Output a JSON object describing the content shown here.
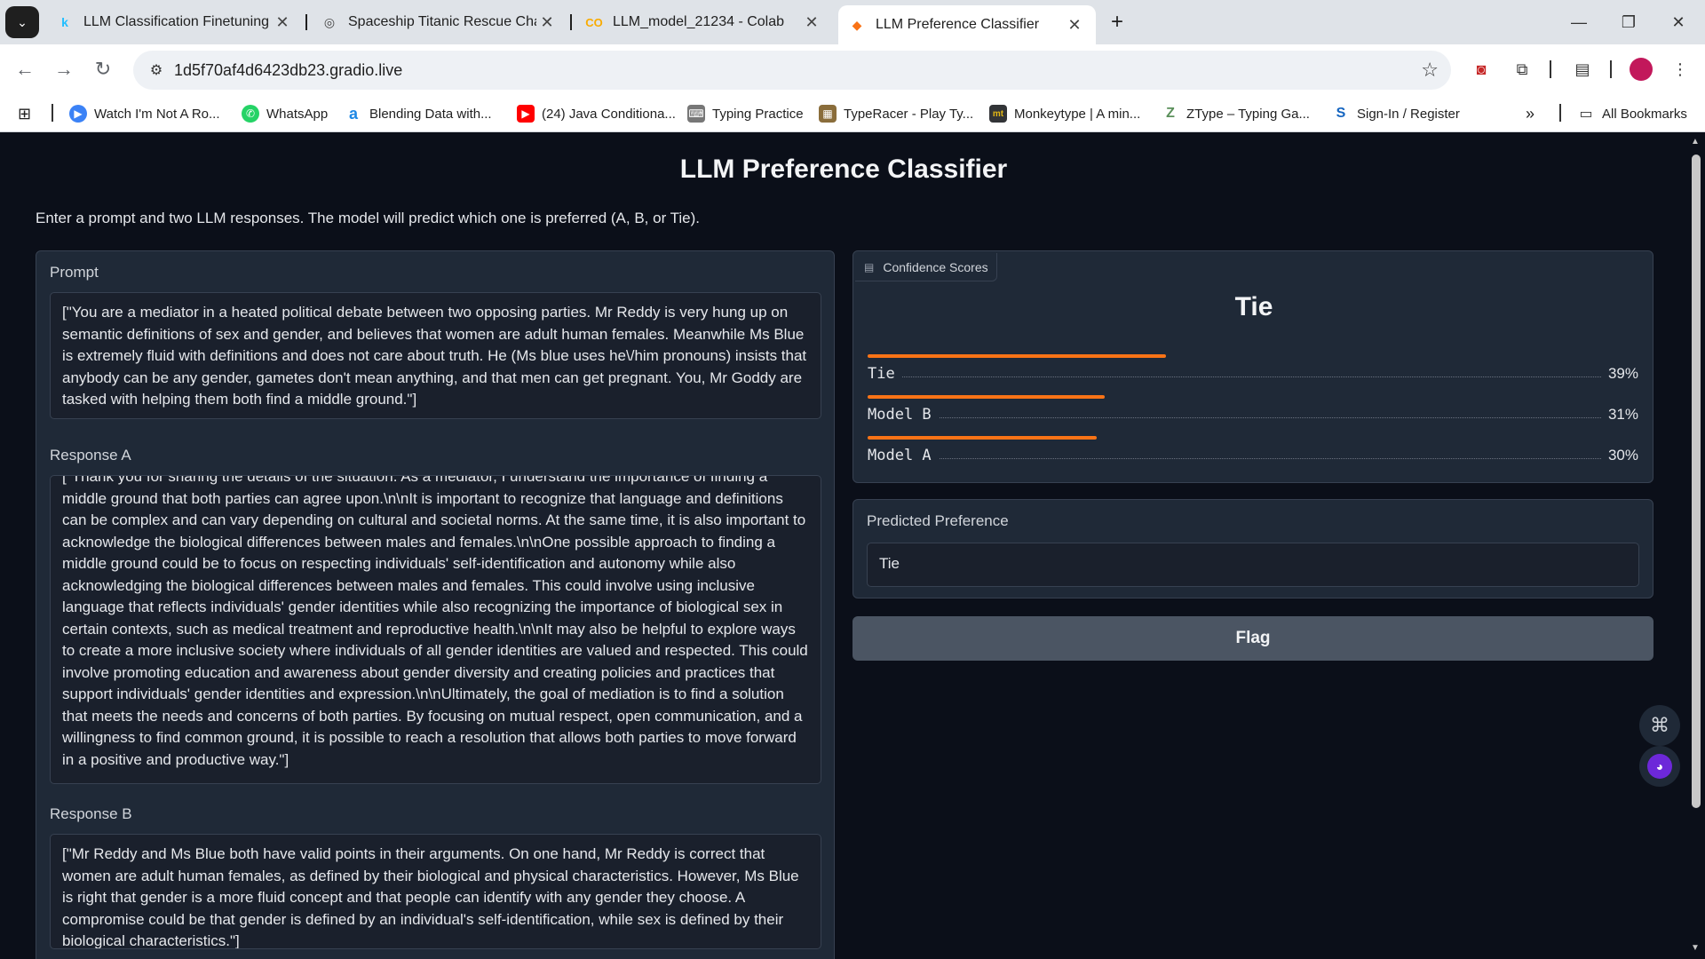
{
  "browser": {
    "tabs": [
      {
        "label": "LLM Classification Finetuning | K",
        "favicon": "k",
        "color": "#20beff"
      },
      {
        "label": "Spaceship Titanic Rescue Challe",
        "favicon": "◎",
        "color": "#444444"
      },
      {
        "label": "LLM_model_21234 - Colab",
        "favicon": "CO",
        "color": "#f9ab00"
      },
      {
        "label": "LLM Preference Classifier",
        "favicon": "◆",
        "color": "#f97316"
      }
    ],
    "url": "1d5f70af4d6423db23.gradio.live",
    "bookmarks": [
      {
        "label": "Watch I'm Not A Ro...",
        "icon_color": "#3b82f6",
        "glyph": "▶"
      },
      {
        "label": "WhatsApp",
        "icon_color": "#25d366",
        "glyph": "✆"
      },
      {
        "label": "Blending Data with...",
        "icon_color": "#1e88e5",
        "glyph": "a"
      },
      {
        "label": "(24) Java Conditiona...",
        "icon_color": "#ff0000",
        "glyph": "▶"
      },
      {
        "label": "Typing Practice",
        "icon_color": "#777777",
        "glyph": "⌨"
      },
      {
        "label": "TypeRacer - Play Ty...",
        "icon_color": "#8a6d3b",
        "glyph": "▦"
      },
      {
        "label": "Monkeytype | A min...",
        "icon_color": "#323437",
        "glyph": "mt"
      },
      {
        "label": "ZType – Typing Ga...",
        "icon_color": "#5a8f5a",
        "glyph": "Z"
      },
      {
        "label": "Sign-In / Register",
        "icon_color": "#1565c0",
        "glyph": "S"
      }
    ],
    "all_bookmarks": "All Bookmarks"
  },
  "app": {
    "title": "LLM Preference Classifier",
    "description": "Enter a prompt and two LLM responses. The model will predict which one is preferred (A, B, or Tie).",
    "prompt": {
      "label": "Prompt",
      "value": "[\"You are a mediator in a heated political debate between two opposing parties. Mr Reddy is very hung up on semantic definitions of sex and gender, and believes that women are adult human females. Meanwhile Ms Blue is extremely fluid with definitions and does not care about truth. He (Ms blue uses he\\/him pronouns) insists that anybody can be any gender, gametes don't mean anything, and that men can get pregnant. You, Mr Goddy are tasked with helping them both find a middle ground.\"]"
    },
    "response_a": {
      "label": "Response A",
      "value": "[\"Thank you for sharing the details of the situation. As a mediator, I understand the importance of finding a middle ground that both parties can agree upon.\\n\\nIt is important to recognize that language and definitions can be complex and can vary depending on cultural and societal norms. At the same time, it is also important to acknowledge the biological differences between males and females.\\n\\nOne possible approach to finding a middle ground could be to focus on respecting individuals' self-identification and autonomy while also acknowledging the biological differences between males and females. This could involve using inclusive language that reflects individuals' gender identities while also recognizing the importance of biological sex in certain contexts, such as medical treatment and reproductive health.\\n\\nIt may also be helpful to explore ways to create a more inclusive society where individuals of all gender identities are valued and respected. This could involve promoting education and awareness about gender diversity and creating policies and practices that support individuals' gender identities and expression.\\n\\nUltimately, the goal of mediation is to find a solution that meets the needs and concerns of both parties. By focusing on mutual respect, open communication, and a willingness to find common ground, it is possible to reach a resolution that allows both parties to move forward in a positive and productive way.\"]"
    },
    "response_b": {
      "label": "Response B",
      "value": " [\"Mr Reddy and Ms Blue both have valid points in their arguments. On one hand, Mr Reddy is correct that women are adult human females, as defined by their biological and physical characteristics. However, Ms Blue is right that gender is a more fluid concept and that people can identify with any gender they choose. A compromise could be that gender is defined by an individual's self-identification, while sex is defined by their biological characteristics.\"]"
    },
    "confidence": {
      "tab_label": "Confidence Scores",
      "top_label": "Tie",
      "rows": [
        {
          "label": "Tie",
          "pct": "39%",
          "fraction": 0.39
        },
        {
          "label": "Model B",
          "pct": "31%",
          "fraction": 0.31
        },
        {
          "label": "Model A",
          "pct": "30%",
          "fraction": 0.3
        }
      ],
      "accent": "#f97316"
    },
    "predicted": {
      "label": "Predicted Preference",
      "value": "Tie"
    },
    "flag_label": "Flag"
  }
}
